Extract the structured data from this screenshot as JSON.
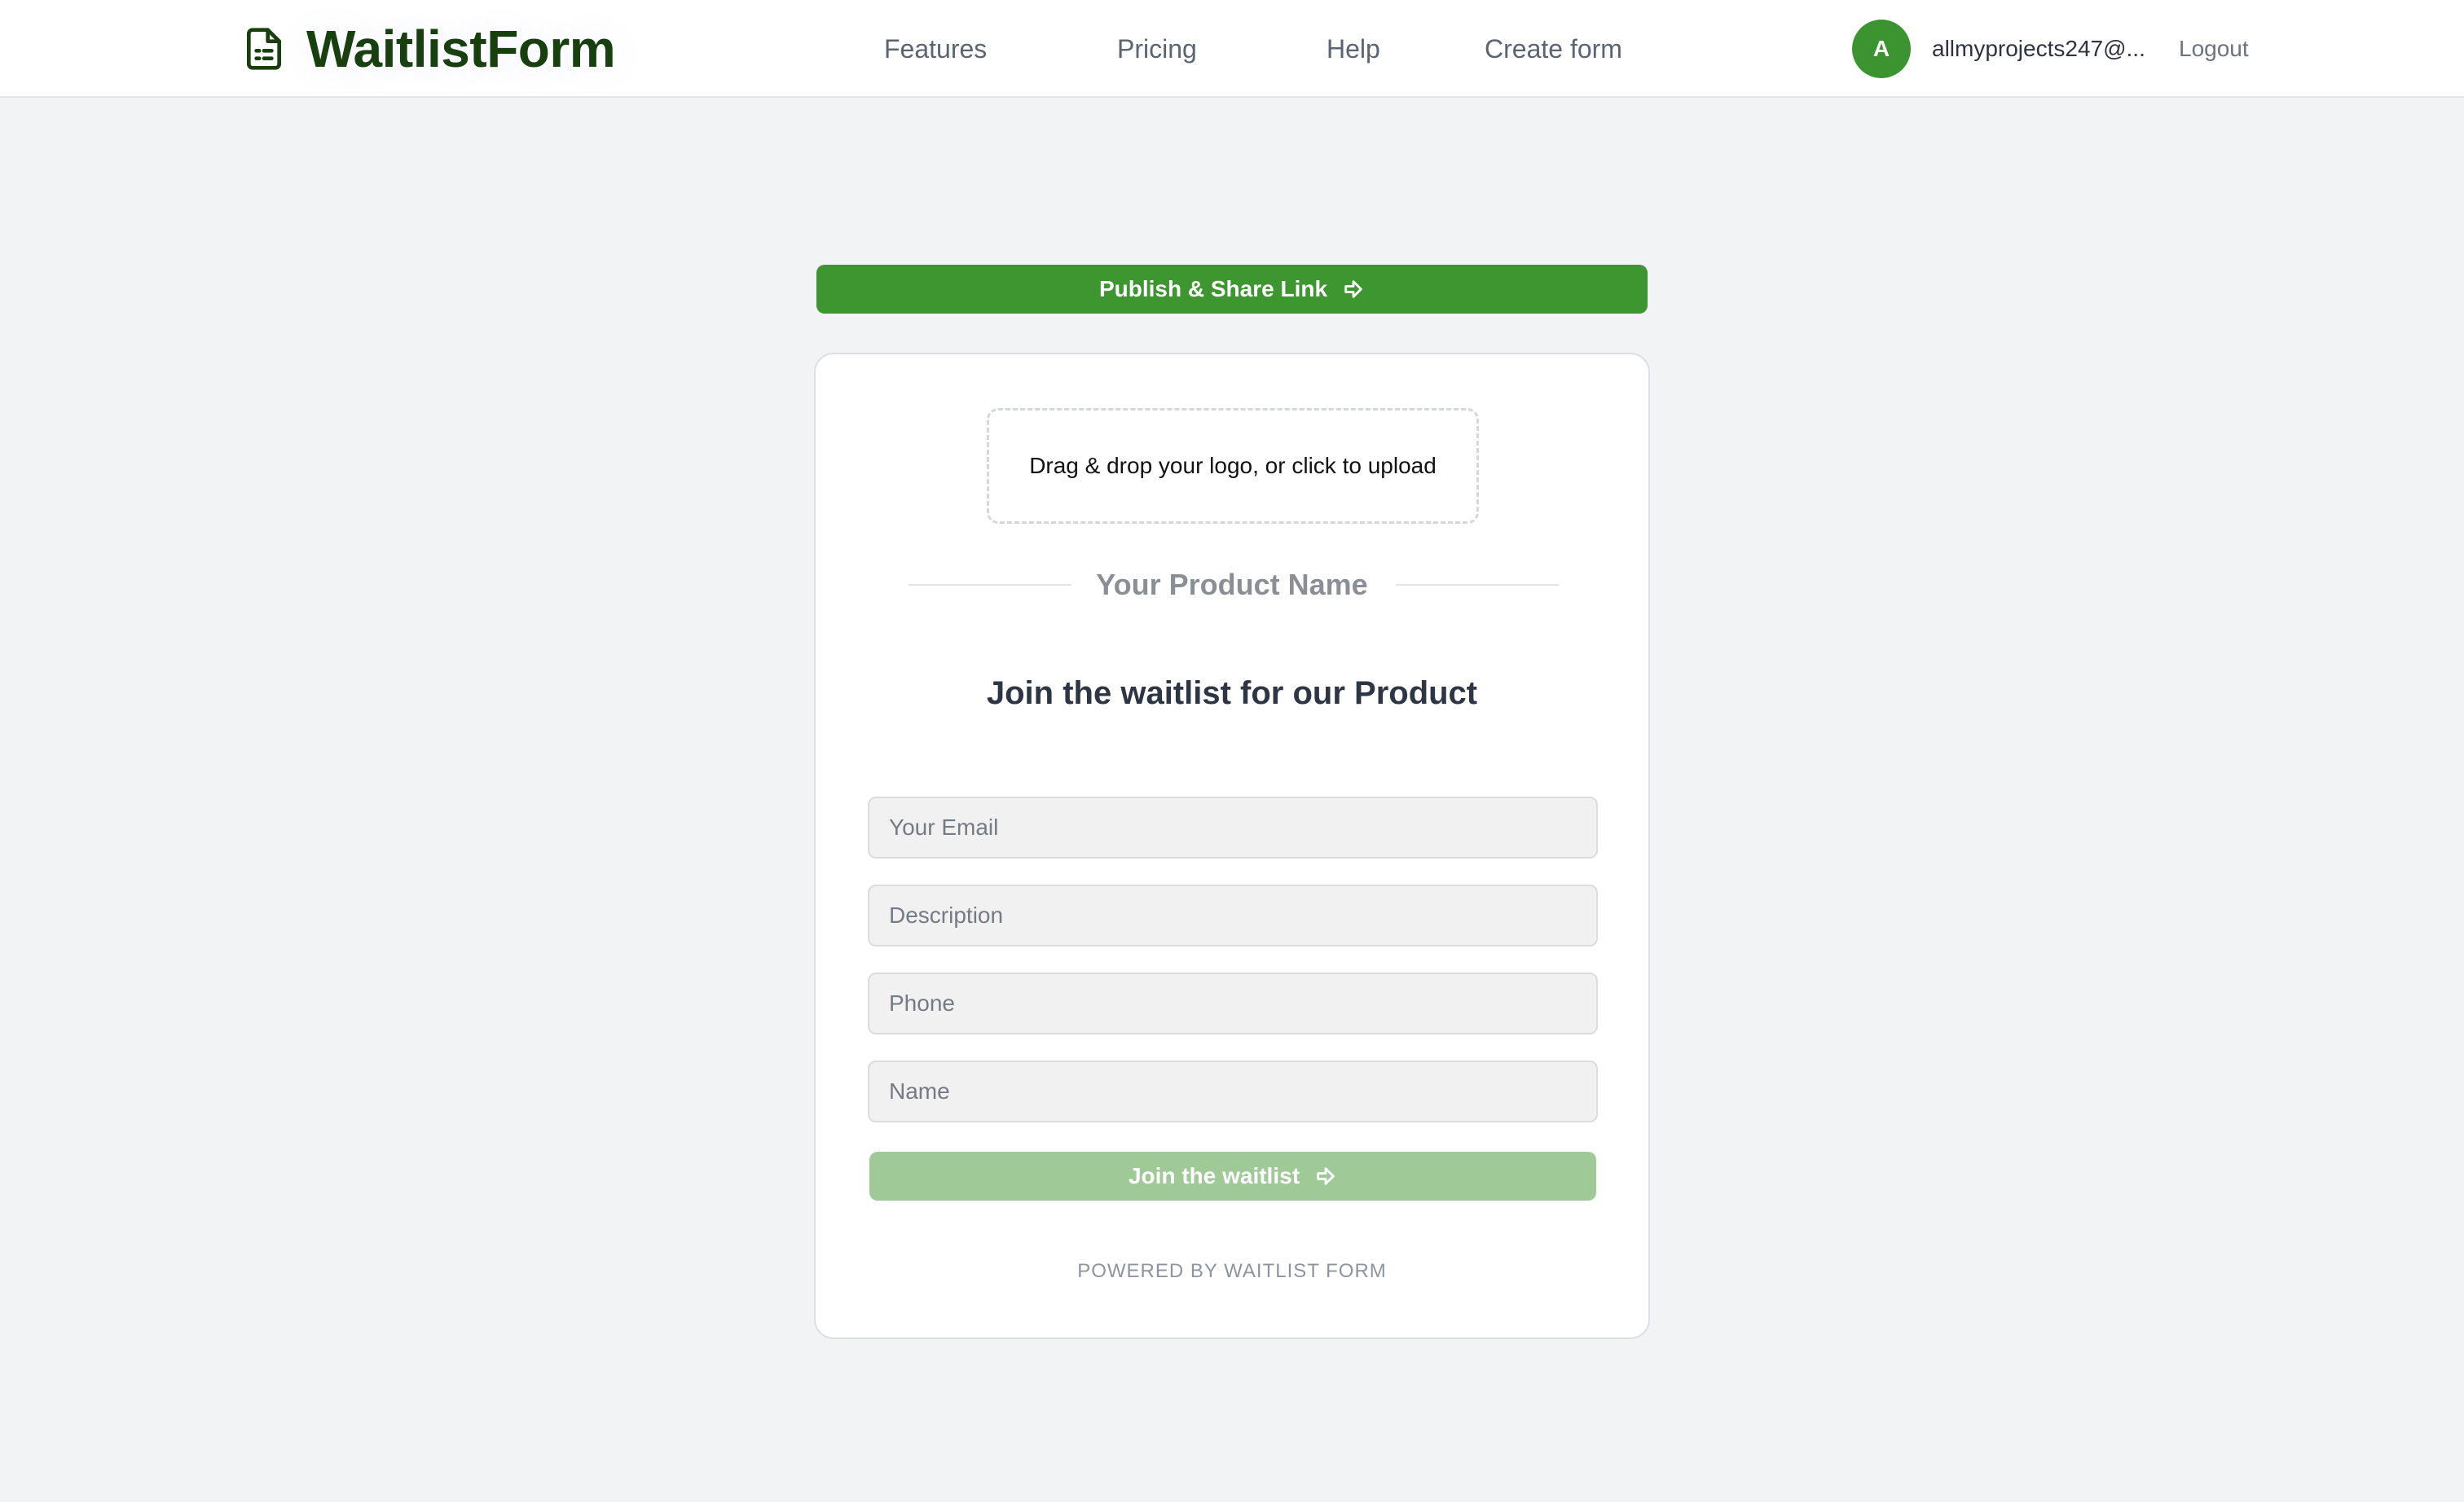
{
  "header": {
    "brand": "WaitlistForm",
    "nav": {
      "features": "Features",
      "pricing": "Pricing",
      "help": "Help",
      "create_form": "Create form"
    },
    "avatar_initial": "A",
    "user_email": "allmyprojects247@...",
    "logout": "Logout"
  },
  "publish_button": {
    "label": "Publish & Share Link",
    "icon": "arrow-right-icon"
  },
  "form": {
    "upload_text": "Drag & drop your logo, or click to upload",
    "product_name": "Your Product Name",
    "headline": "Join the waitlist for our Product",
    "fields": {
      "email_placeholder": "Your Email",
      "description_placeholder": "Description",
      "phone_placeholder": "Phone",
      "name_placeholder": "Name"
    },
    "submit_label": "Join the waitlist",
    "footer": "POWERED BY WAITLIST FORM"
  },
  "colors": {
    "brand_green": "#3d962f",
    "brand_text": "#18400f",
    "disabled_green": "#a0c998",
    "page_bg": "#f2f3f5"
  }
}
